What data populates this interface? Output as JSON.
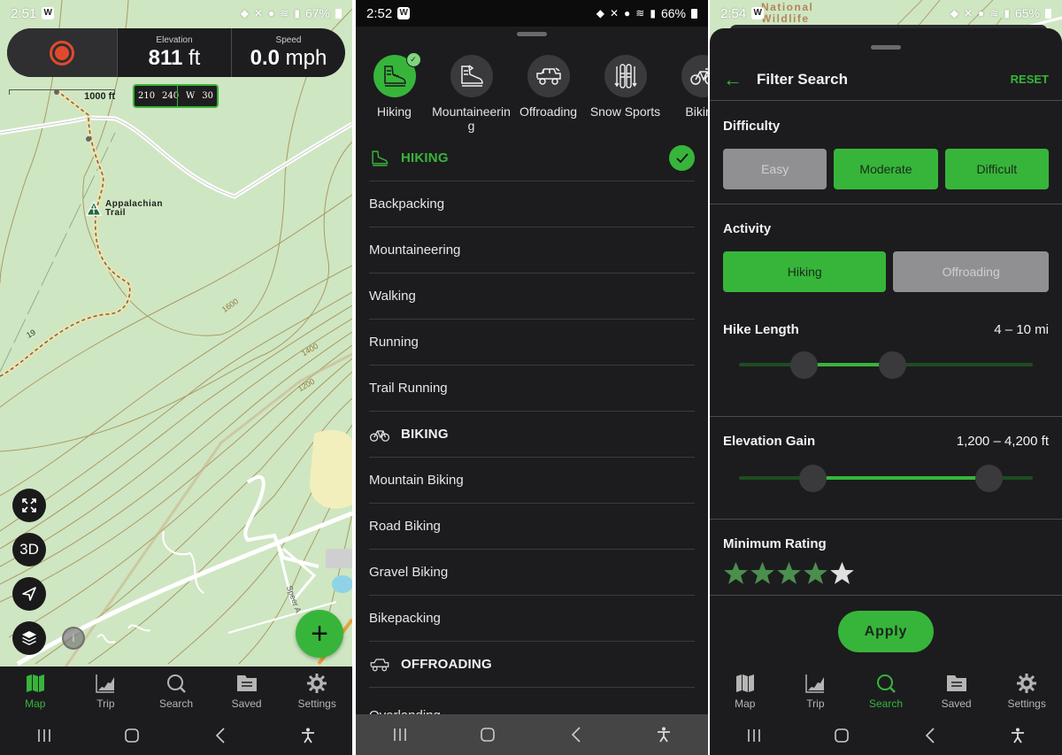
{
  "panels": {
    "map_screen": {
      "status": {
        "time": "2:51",
        "battery": "67%"
      },
      "hud": {
        "record_icon": "record-icon",
        "elevation_label": "Elevation",
        "elevation_value": "811",
        "elevation_unit": "ft",
        "speed_label": "Speed",
        "speed_value": "0.0",
        "speed_unit": "mph"
      },
      "scale_text": "1000 ft",
      "compass": {
        "ticks": [
          "210",
          "240",
          "W",
          "30"
        ]
      },
      "map_labels": {
        "trail_line1": "Appalachian",
        "trail_line2": "Trail",
        "contour_1600": "1600",
        "contour_1400": "1400",
        "contour_1200": "1200",
        "route_number": "19",
        "street": "Speer A"
      },
      "map_buttons": {
        "fullscreen": "expand-icon",
        "three_d": "3D",
        "locate": "navigation-arrow-icon",
        "layers": "layers-icon",
        "info": "i",
        "add": "+"
      },
      "active_tab": "Map"
    },
    "activity_screen": {
      "status": {
        "time": "2:52",
        "battery": "66%"
      },
      "categories": [
        {
          "label": "Hiking",
          "selected": true
        },
        {
          "label": "Mountaineering",
          "selected": false
        },
        {
          "label": "Offroading",
          "selected": false
        },
        {
          "label": "Snow Sports",
          "selected": false
        },
        {
          "label": "Biking",
          "selected": false
        }
      ],
      "sections": [
        {
          "header": "HIKING",
          "active": true,
          "items": [
            "Backpacking",
            "Mountaineering",
            "Walking",
            "Running",
            "Trail Running"
          ]
        },
        {
          "header": "BIKING",
          "active": false,
          "items": [
            "Mountain Biking",
            "Road Biking",
            "Gravel Biking",
            "Bikepacking"
          ]
        },
        {
          "header": "OFFROADING",
          "active": false,
          "items": [
            "Overlanding"
          ]
        }
      ]
    },
    "filter_screen": {
      "status": {
        "time": "2:54",
        "battery": "65%"
      },
      "map_peek_text": [
        "National",
        "Wildlife"
      ],
      "title": "Filter Search",
      "reset_label": "RESET",
      "difficulty": {
        "label": "Difficulty",
        "options": [
          {
            "label": "Easy",
            "selected": false
          },
          {
            "label": "Moderate",
            "selected": true
          },
          {
            "label": "Difficult",
            "selected": true
          }
        ]
      },
      "activity": {
        "label": "Activity",
        "options": [
          {
            "label": "Hiking",
            "selected": true
          },
          {
            "label": "Offroading",
            "selected": false
          }
        ]
      },
      "hike_length": {
        "label": "Hike Length",
        "range_text": "4 – 10 mi",
        "low_fraction": 0.22,
        "high_fraction": 0.52
      },
      "elevation_gain": {
        "label": "Elevation Gain",
        "range_text": "1,200 – 4,200 ft",
        "low_fraction": 0.25,
        "high_fraction": 0.85
      },
      "minimum_rating": {
        "label": "Minimum Rating",
        "value": 4,
        "max": 5
      },
      "apply_label": "Apply",
      "active_tab": "Search"
    }
  },
  "tabs": [
    {
      "label": "Map",
      "icon": "map-icon"
    },
    {
      "label": "Trip",
      "icon": "chart-icon"
    },
    {
      "label": "Search",
      "icon": "search-icon"
    },
    {
      "label": "Saved",
      "icon": "folder-icon"
    },
    {
      "label": "Settings",
      "icon": "gear-icon"
    }
  ],
  "colors": {
    "accent": "#37b53a",
    "record": "#e04a2b",
    "sheet_bg": "#1c1c1e",
    "map_bg": "#cfe6c2",
    "star_filled": "#4a8f4d",
    "star_empty": "#e0e0e0",
    "option_off": "#909092"
  }
}
